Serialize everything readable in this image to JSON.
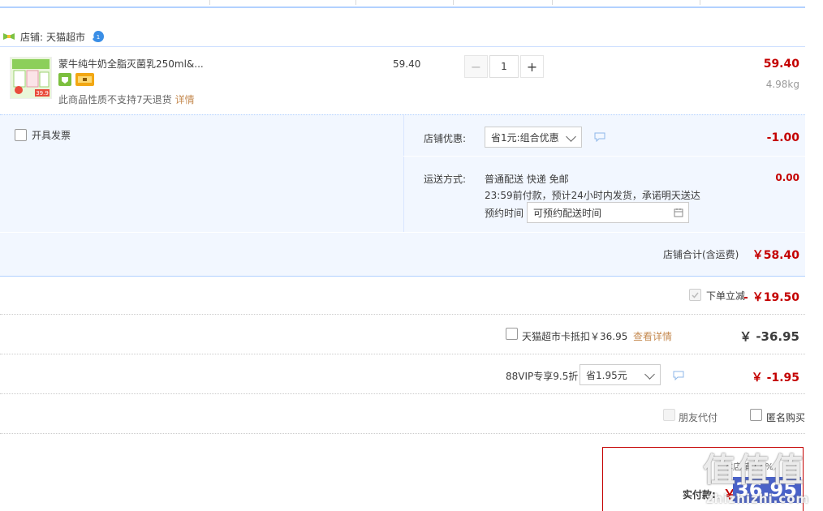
{
  "shop": {
    "label": "店铺:",
    "name": "天猫超市"
  },
  "item": {
    "title": "蒙牛纯牛奶全脂灭菌乳250ml&...",
    "notice": "此商品性质不支持7天退货",
    "notice_link": "详情",
    "unit_price": "59.40",
    "quantity": "1",
    "minus_label": "−",
    "plus_label": "+",
    "subtotal": "59.40",
    "weight": "4.98kg",
    "thumb_price": "39.9"
  },
  "invoice": {
    "label": "开具发票"
  },
  "shop_discount": {
    "label": "店铺优惠:",
    "selected": "省1元:组合优惠",
    "value": "-1.00"
  },
  "shipping": {
    "label": "运送方式:",
    "line1": "普通配送 快递 免邮",
    "line2": "23:59前付款，预计24小时内发货，承诺明天送达",
    "appt_label": "预约时间",
    "appt_placeholder": "可预约配送时间",
    "fee": "0.00"
  },
  "shop_total": {
    "label": "店铺合计(含运费)",
    "value": "￥58.40"
  },
  "instant_discount": {
    "label": "下单立减",
    "value": "- ￥19.50"
  },
  "card_deduct": {
    "label": "天猫超市卡抵扣￥36.95",
    "link": "查看详情",
    "value": "￥ -36.95"
  },
  "vip": {
    "label": "88VIP专享9.5折",
    "selected": "省1.95元",
    "value": "￥ -1.95"
  },
  "friend_pay": {
    "label": "朋友代付"
  },
  "anonymous": {
    "label": "匿名购买"
  },
  "payment": {
    "label": "实付款:",
    "currency": "￥",
    "value": "36.95",
    "note": "本店铺9.4%"
  },
  "watermark": {
    "big": "值值值",
    "small": "zhizhizhi.com"
  },
  "colors": {
    "price_red": "#c40000",
    "border_blue": "#b2d1ff",
    "panel_bg": "#f2f7ff",
    "link_brown": "#c58a50"
  }
}
